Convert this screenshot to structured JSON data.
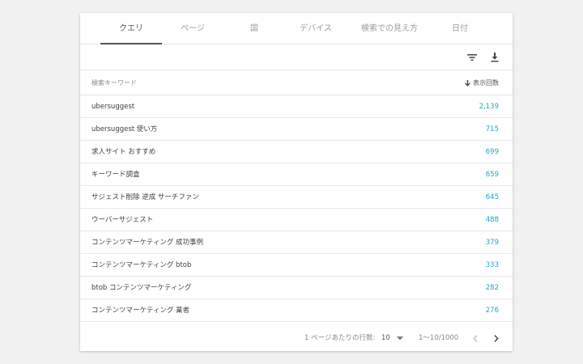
{
  "tabs": [
    {
      "label": "クエリ",
      "active": true
    },
    {
      "label": "ページ",
      "active": false
    },
    {
      "label": "国",
      "active": false
    },
    {
      "label": "デバイス",
      "active": false
    },
    {
      "label": "検索での見え方",
      "active": false
    },
    {
      "label": "日付",
      "active": false
    }
  ],
  "toolbar": {
    "filter_icon": "filter-icon",
    "download_icon": "download-icon"
  },
  "table": {
    "col_keyword": "検索キーワード",
    "col_impressions": "表示回数",
    "sort_icon": "arrow-down-icon",
    "value_color": "#1ca8c4",
    "rows": [
      {
        "query": "ubersuggest",
        "value": "2,139"
      },
      {
        "query": "ubersuggest 使い方",
        "value": "715"
      },
      {
        "query": "求人サイト おすすめ",
        "value": "699"
      },
      {
        "query": "キーワード調査",
        "value": "659"
      },
      {
        "query": "サジェスト削除 逆成 サーチファン",
        "value": "645"
      },
      {
        "query": "ウーバーサジェスト",
        "value": "488"
      },
      {
        "query": "コンテンツマーケティング 成功事例",
        "value": "379"
      },
      {
        "query": "コンテンツマーケティング btob",
        "value": "333"
      },
      {
        "query": "btob コンテンツマーケティング",
        "value": "282"
      },
      {
        "query": "コンテンツマーケティング 業者",
        "value": "276"
      }
    ]
  },
  "pagination": {
    "rows_per_page_label": "1 ページあたりの行数:",
    "rows_per_page_value": "10",
    "range": "1～10/1000",
    "prev_icon": "chevron-left-icon",
    "next_icon": "chevron-right-icon"
  }
}
